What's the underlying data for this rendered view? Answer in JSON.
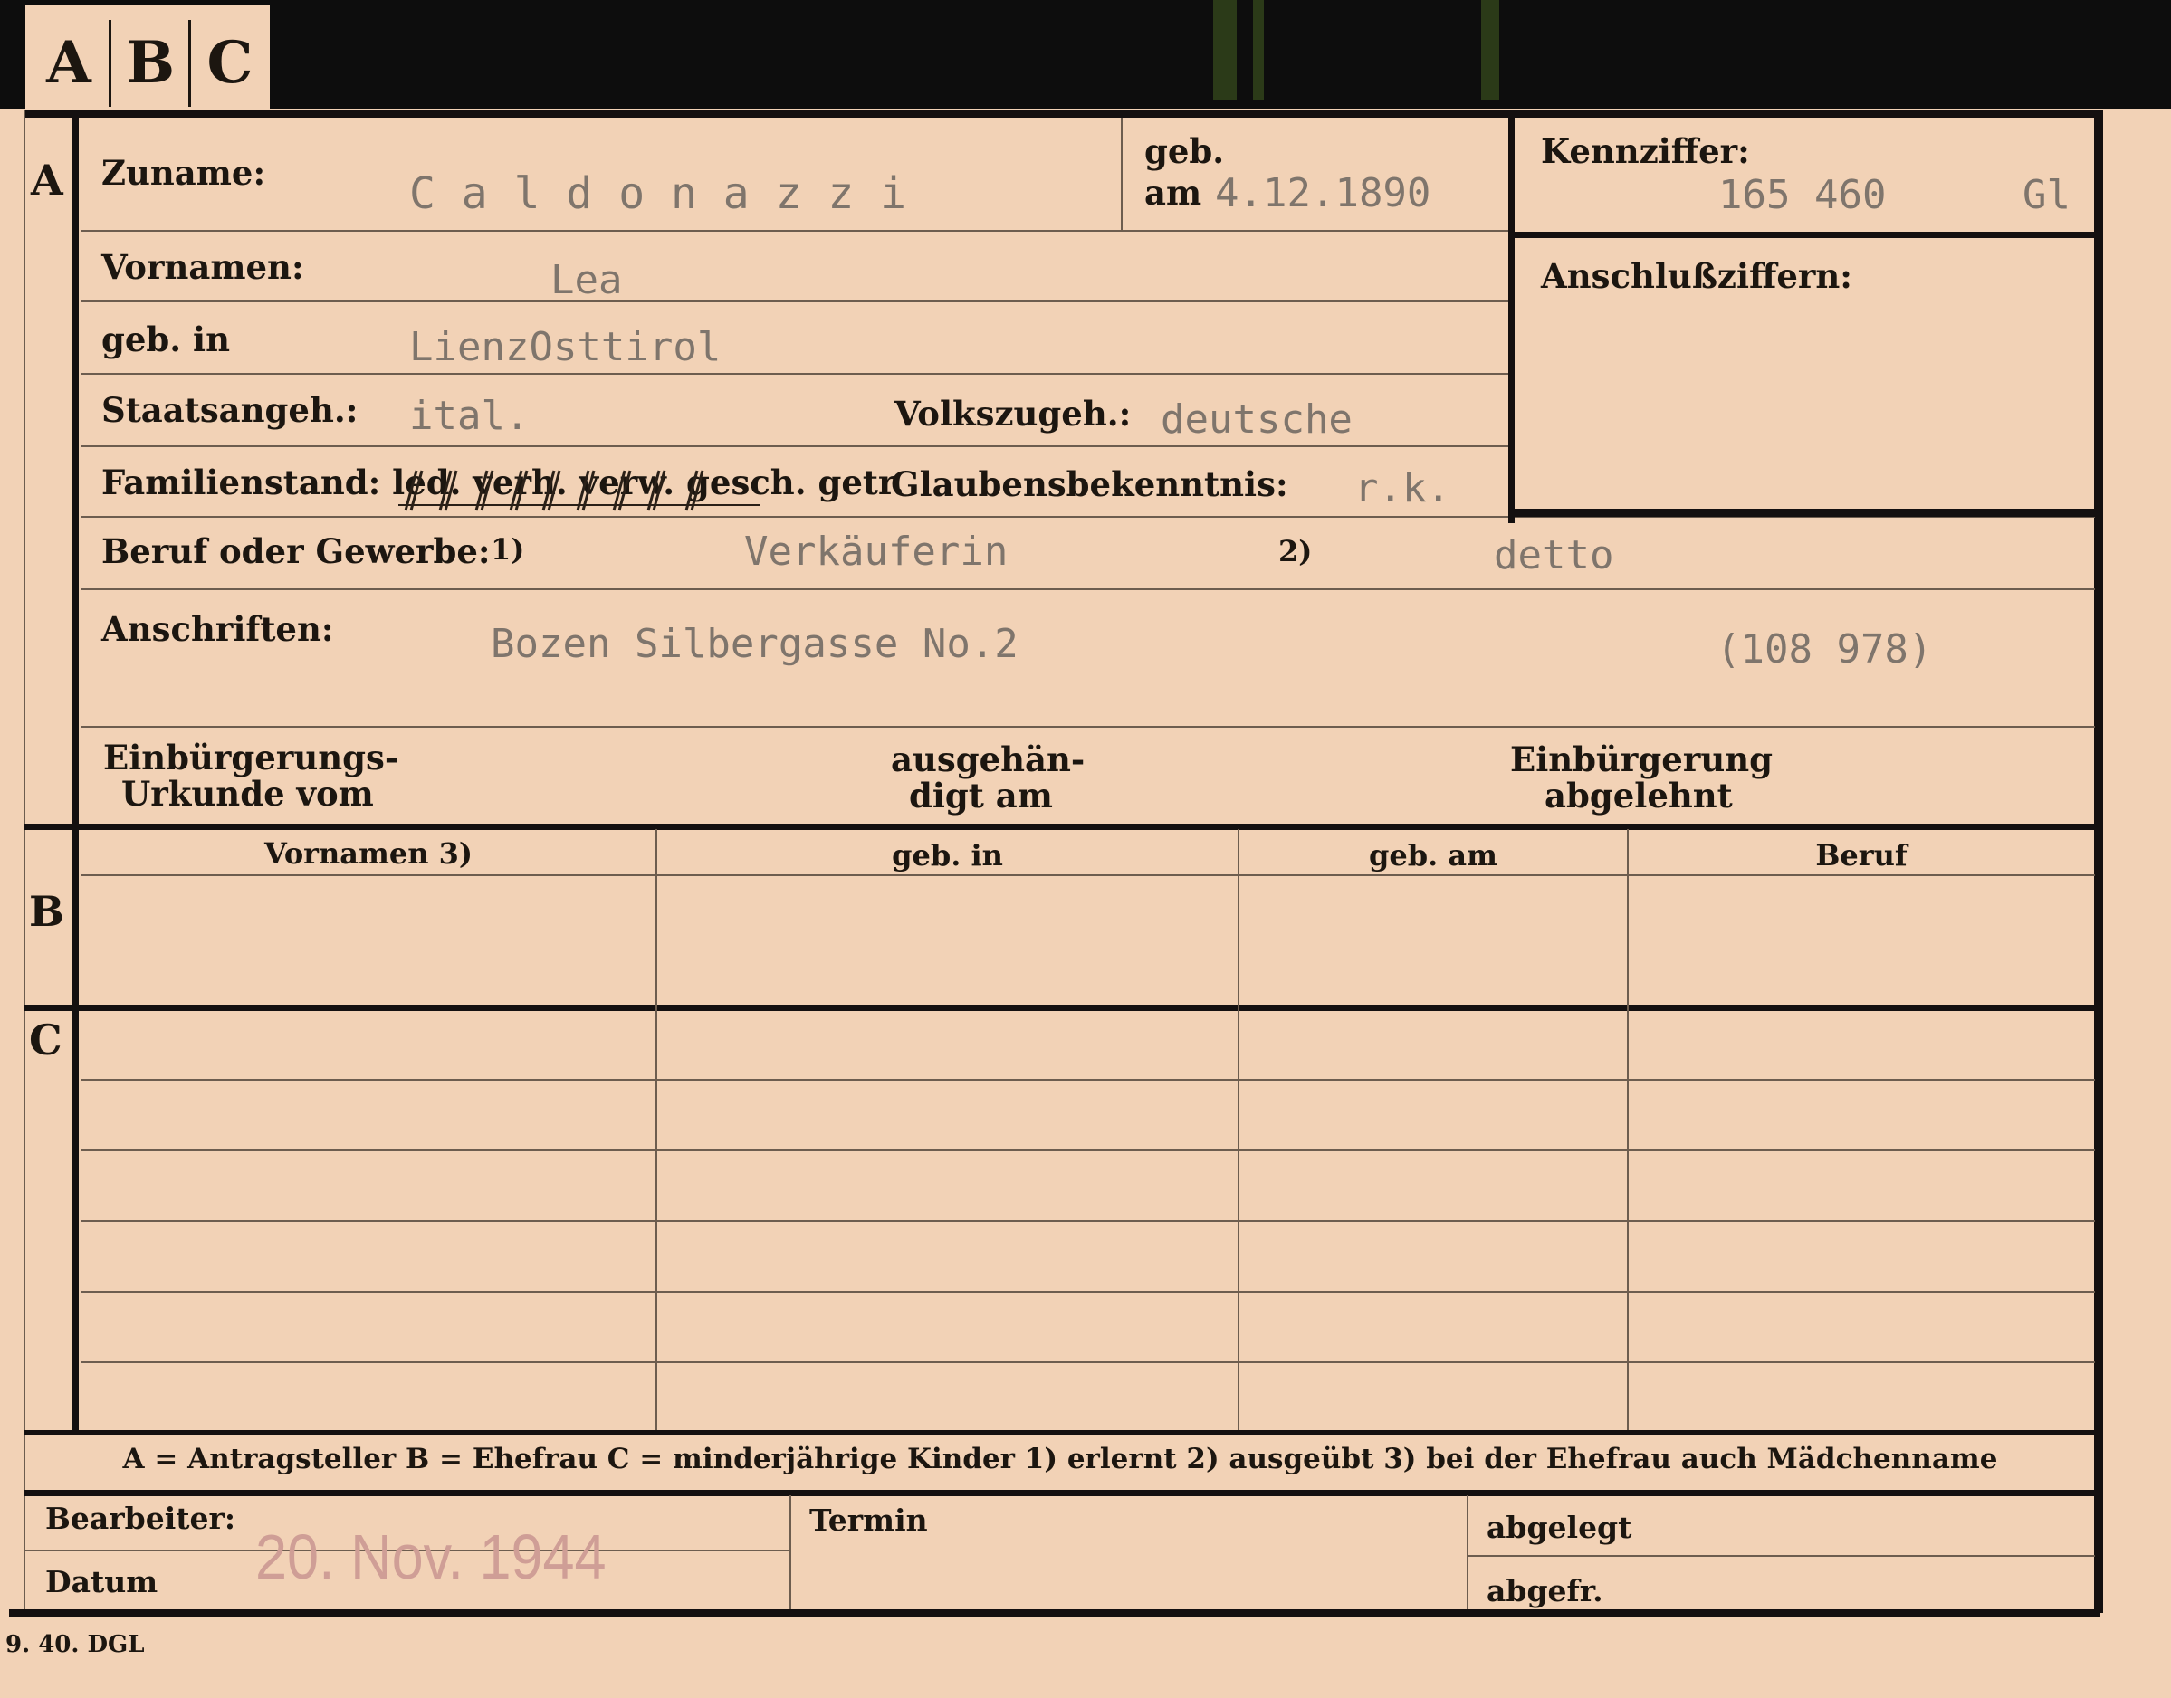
{
  "tabs": [
    "A",
    "B",
    "C"
  ],
  "section_letters": {
    "a": "A",
    "b": "B",
    "c": "C"
  },
  "labels": {
    "zuname": "Zuname:",
    "geb": "geb.",
    "am": "am",
    "kennziffer": "Kennziffer:",
    "vornamen": "Vornamen:",
    "anschlussziffern": "Anschlußziffern:",
    "geb_in": "geb. in",
    "staatsangeh": "Staatsangeh.:",
    "volkszugeh": "Volkszugeh.:",
    "familienstand": "Familienstand: led. verh. verw. gesch. getr.",
    "glaubensbekenntnis": "Glaubensbekenntnis:",
    "beruf_oder_gewerbe": "Beruf oder Gewerbe:",
    "fn1": "1)",
    "fn2": "2)",
    "anschriften": "Anschriften:",
    "einbuergerungs_1": "Einbürgerungs-",
    "einbuergerungs_2": "Urkunde vom",
    "ausgehaendigt_1": "ausgehän-",
    "ausgehaendigt_2": "digt am",
    "einbuergerung_1": "Einbürgerung",
    "einbuergerung_2": "abgelehnt",
    "bearbeiter": "Bearbeiter:",
    "datum": "Datum",
    "termin": "Termin",
    "abgelegt": "abgelegt",
    "abgefr": "abgefr."
  },
  "table_headers": [
    "Vornamen 3)",
    "geb. in",
    "geb. am",
    "Beruf"
  ],
  "legend": "A = Antragsteller   B = Ehefrau   C = minderjährige Kinder   1) erlernt   2) ausgeübt   3) bei der Ehefrau auch Mädchenname",
  "values": {
    "zuname": "C a l d o n a z z i",
    "geb_am": "4.12.1890",
    "kennziffer": "165 460",
    "kennziffer_code": "Gl",
    "vornamen": "Lea",
    "geb_in": "LienzOsttirol",
    "staatsangeh": "ital.",
    "volkszugeh": "deutsche",
    "glaubensbekenntnis": "r.k.",
    "beruf_erlernt": "Verkäuferin",
    "beruf_ausgeuebt": "detto",
    "anschrift": "Bozen Silbergasse No.2",
    "anschrift_nr": "(108 978)",
    "datum_stamp": "20. Nov. 1944"
  },
  "footer_print": "9. 40. DGL",
  "colors": {
    "card": "#f2d2b6",
    "ink": "#1c1610",
    "typewriter": "#7f756c",
    "stamp": "#cf9e96",
    "background": "#0d0d0d"
  }
}
